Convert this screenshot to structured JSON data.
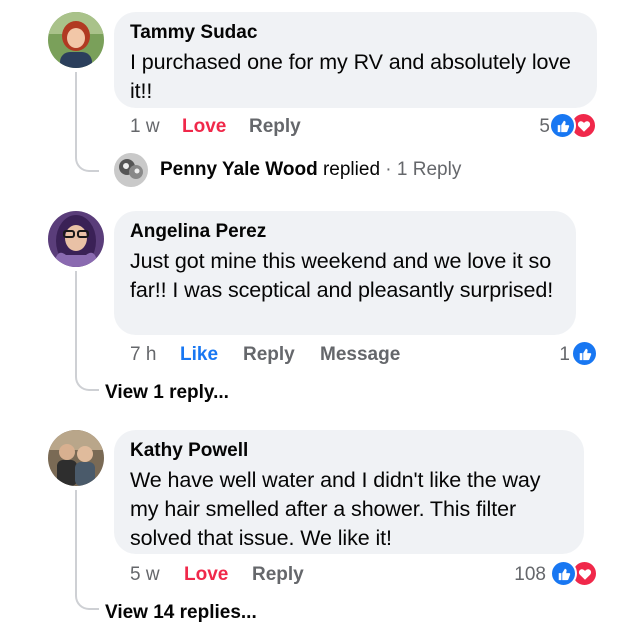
{
  "comments": [
    {
      "author": "Tammy Sudac",
      "text": "I purchased one for my RV and absolutely love it!!",
      "time": "1 w",
      "reaction_action": "Love",
      "reply_label": "Reply",
      "reaction_count": "5",
      "reactions": [
        "like",
        "love"
      ],
      "reply_preview": {
        "author": "Penny Yale Wood",
        "verb": "replied",
        "count_text": "· 1 Reply"
      }
    },
    {
      "author": "Angelina Perez",
      "text": "Just got mine this weekend and we love it so far!! I was sceptical and pleasantly surprised!",
      "time": "7 h",
      "reaction_action": "Like",
      "reply_label": "Reply",
      "message_label": "Message",
      "reaction_count": "1",
      "reactions": [
        "like"
      ],
      "view_replies": "View 1 reply..."
    },
    {
      "author": "Kathy Powell",
      "text": "We have well water and I didn't like the way my hair smelled after a shower. This filter solved that issue. We like it!",
      "time": "5 w",
      "reaction_action": "Love",
      "reply_label": "Reply",
      "reaction_count": "108",
      "reactions": [
        "like",
        "love"
      ],
      "view_replies": "View 14 replies..."
    }
  ],
  "colors": {
    "bubble": "#f0f2f5",
    "like_blue": "#1877f2",
    "love_red": "#f0284a",
    "muted": "#65676b",
    "thread_line": "#ced0d4"
  }
}
